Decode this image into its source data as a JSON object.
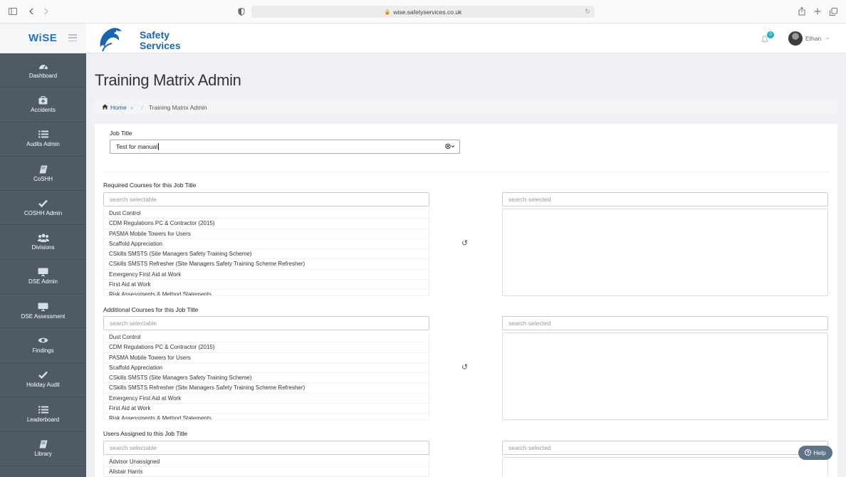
{
  "browser": {
    "url": "wise.safetyservices.co.uk",
    "icons": [
      "sidebar-toggle-icon",
      "back-icon",
      "forward-icon",
      "shield-icon",
      "lock-icon",
      "reload-icon",
      "share-icon",
      "new-tab-icon",
      "tabs-icon"
    ]
  },
  "sidebar": {
    "brand": "WiSE",
    "items": [
      {
        "label": "Dashboard",
        "icon": "dashboard-icon"
      },
      {
        "label": "Accidents",
        "icon": "medkit-icon"
      },
      {
        "label": "Audits Admin",
        "icon": "list-icon"
      },
      {
        "label": "CoSHH",
        "icon": "book-icon"
      },
      {
        "label": "COSHH Admin",
        "icon": "check-icon"
      },
      {
        "label": "Divisions",
        "icon": "users-icon"
      },
      {
        "label": "DSE Admin",
        "icon": "monitor-icon"
      },
      {
        "label": "DSE Assessment",
        "icon": "monitor-icon"
      },
      {
        "label": "Findings",
        "icon": "eye-icon"
      },
      {
        "label": "Holiday Audit",
        "icon": "check-icon"
      },
      {
        "label": "Leaderboard",
        "icon": "list-icon"
      },
      {
        "label": "Library",
        "icon": "book-icon"
      }
    ]
  },
  "header": {
    "logo_line1": "Safety",
    "logo_line2": "Services",
    "notification_count": "0",
    "user_name": "Ethan"
  },
  "page": {
    "title": "Training Matrix Admin",
    "breadcrumb_home": "Home",
    "breadcrumb_current": "Training Matrix Admin"
  },
  "form": {
    "job_title_label": "Job Title",
    "job_title_value": "Test for manual",
    "search_selectable_placeholder": "search selectable",
    "search_selected_placeholder": "search selected",
    "required_label": "Required Courses for this Job Title",
    "additional_label": "Additional Courses for this Job Title",
    "users_label": "Users Assigned to this Job Title",
    "courses": [
      "Dust Control",
      "CDM Regulations PC & Contractor (2015)",
      "PASMA Mobile Towers for Users",
      "Scaffold Appreciation",
      "CSkills SMSTS (Site Managers Safety Training Scheme)",
      "CSkills SMSTS Refresher (Site Managers Safety Training Scheme Refresher)",
      "Emergency First Aid at Work",
      "First Aid at Work",
      "Risk Assessments & Method Statements"
    ],
    "users": [
      "Advisor Unassigned",
      "Alistair Harris"
    ]
  },
  "help_label": "Help",
  "colors": {
    "sidebar_bg": "#4e5a66",
    "brand_blue": "#1a66b3",
    "notification_badge": "#1ab0c8",
    "help_button": "#5f7487"
  }
}
